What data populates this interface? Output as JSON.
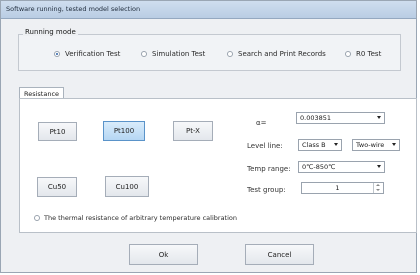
{
  "window": {
    "title": "Software running, tested model selection"
  },
  "running_mode": {
    "title": "Running mode",
    "options": [
      "Verification Test",
      "Simulation Test",
      "Search and Print Records",
      "R0 Test"
    ],
    "selected": "Verification Test"
  },
  "tab": {
    "label": "Resistance"
  },
  "sensors": {
    "pt10": "Pt10",
    "pt100": "Pt100",
    "ptx": "Pt-X",
    "cu50": "Cu50",
    "cu100": "Cu100",
    "selected": "Pt100"
  },
  "settings": {
    "alpha_label": "α=",
    "alpha_value": "0.003851",
    "level_label": "Level line:",
    "level_value": "Class B",
    "wire_value": "Two-wire",
    "temp_label": "Temp range:",
    "temp_value": "0℃-850℃",
    "group_label": "Test group:",
    "group_value": "1"
  },
  "checkbox": {
    "label": "The thermal resistance of arbitrary temperature calibration"
  },
  "buttons": {
    "ok": "Ok",
    "cancel": "Cancel"
  },
  "colors": {
    "selected_button": "#c7e1f7",
    "titlebar": "#c3d6ea",
    "background": "#eef0f3"
  }
}
